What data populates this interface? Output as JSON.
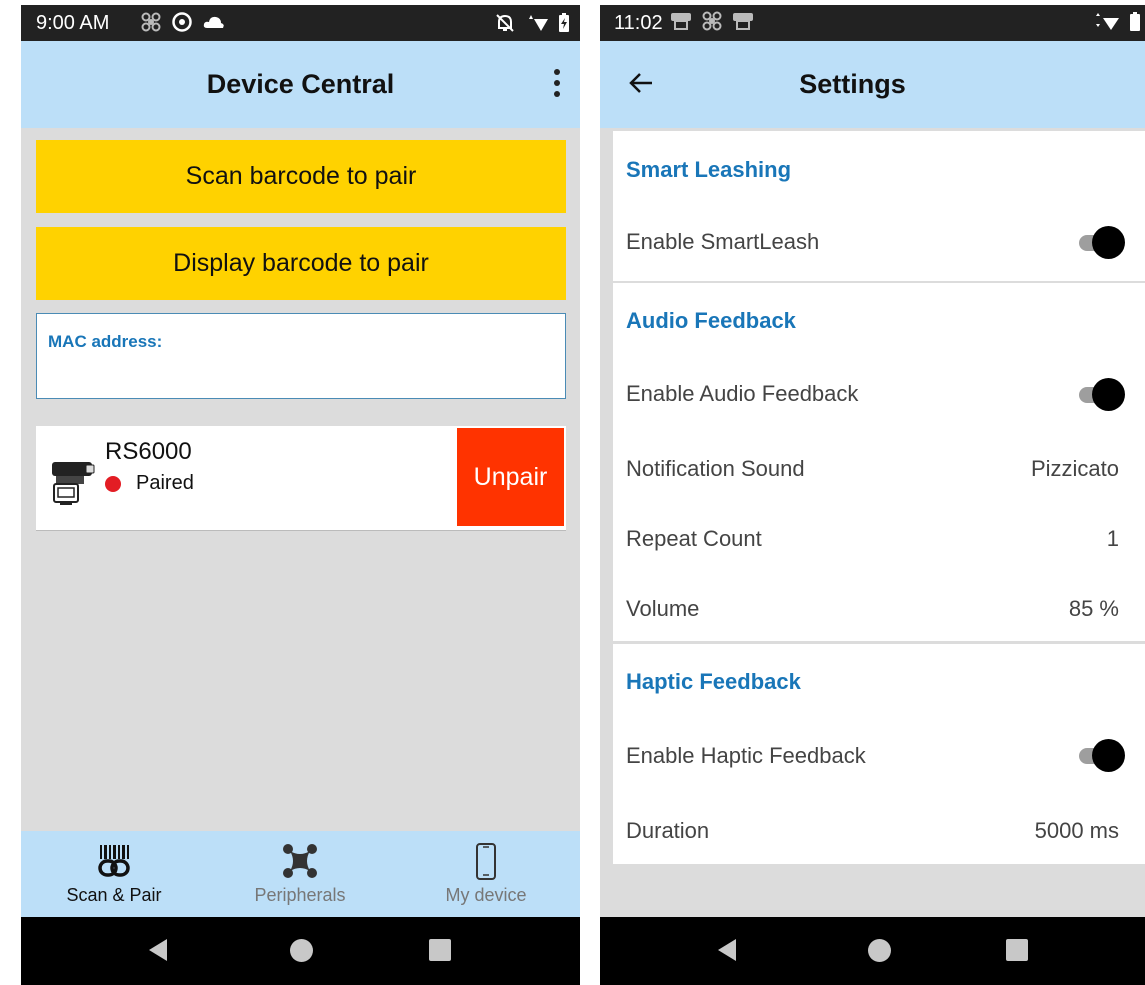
{
  "left": {
    "status": {
      "time": "9:00 AM"
    },
    "appbar": {
      "title": "Device Central"
    },
    "buttons": {
      "scan": "Scan barcode to pair",
      "display": "Display barcode to pair"
    },
    "mac": {
      "label": "MAC address:"
    },
    "device": {
      "name": "RS6000",
      "status": "Paired",
      "status_color": "#e31d24",
      "unpair": "Unpair"
    },
    "nav": [
      {
        "label": "Scan & Pair",
        "icon": "barcode-link-icon",
        "active": true
      },
      {
        "label": "Peripherals",
        "icon": "peripherals-icon",
        "active": false
      },
      {
        "label": "My device",
        "icon": "phone-icon",
        "active": false
      }
    ]
  },
  "right": {
    "status": {
      "time": "11:02"
    },
    "appbar": {
      "title": "Settings"
    },
    "sections": [
      {
        "title": "Smart Leashing",
        "rows": [
          {
            "label": "Enable SmartLeash",
            "toggle": true
          }
        ]
      },
      {
        "title": "Audio Feedback",
        "rows": [
          {
            "label": "Enable Audio Feedback",
            "toggle": true
          },
          {
            "label": "Notification Sound",
            "value": "Pizzicato"
          },
          {
            "label": "Repeat Count",
            "value": "1"
          },
          {
            "label": "Volume",
            "value": "85 %"
          }
        ]
      },
      {
        "title": "Haptic Feedback",
        "rows": [
          {
            "label": "Enable Haptic Feedback",
            "toggle": true
          },
          {
            "label": "Duration",
            "value": "5000 ms"
          }
        ]
      }
    ]
  },
  "colors": {
    "appbar": "#bcdff8",
    "accent_button": "#ffd200",
    "unpair": "#ff3300",
    "section_title": "#1976b8"
  }
}
